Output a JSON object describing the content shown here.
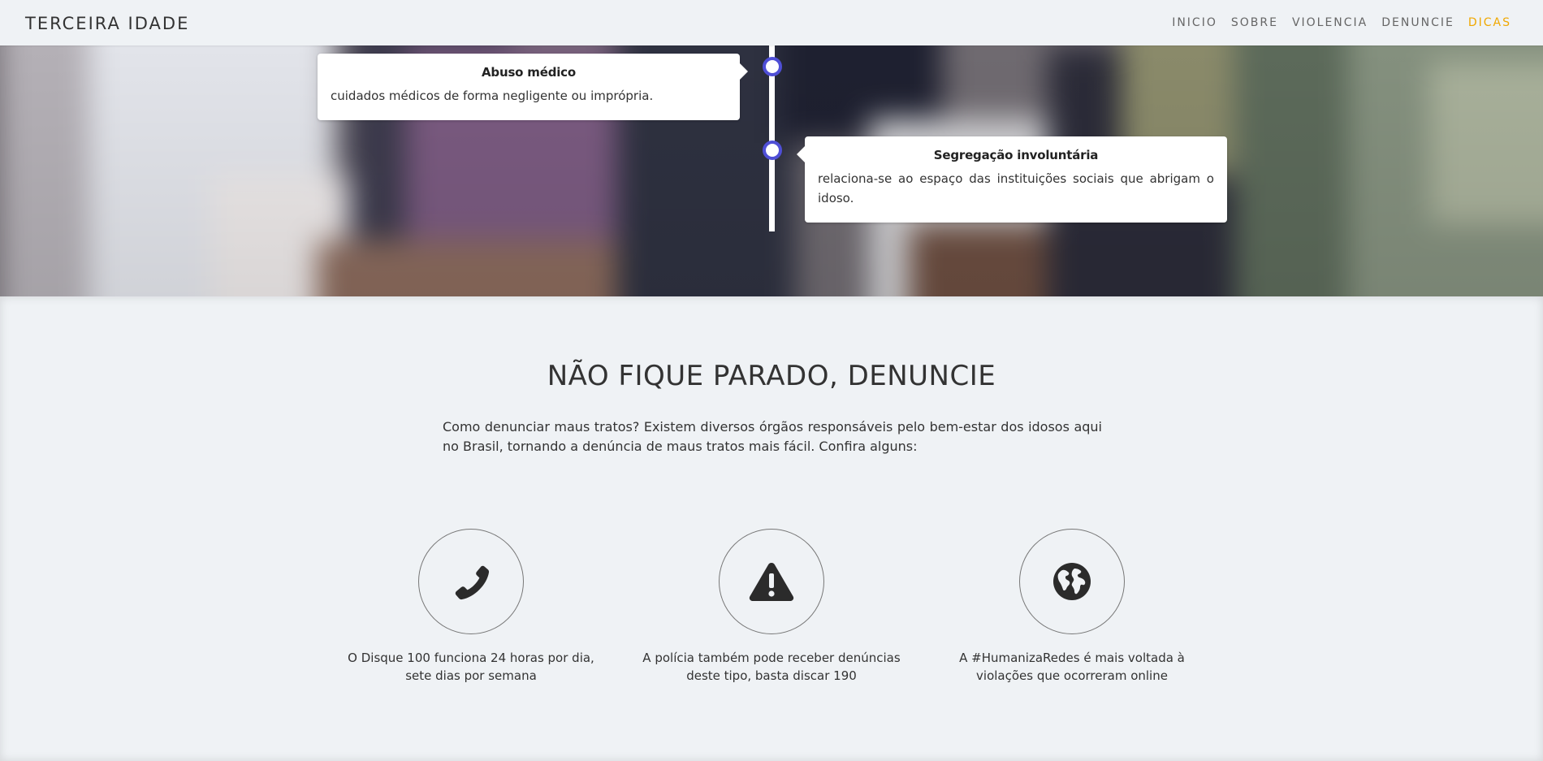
{
  "navbar": {
    "brand": "TERCEIRA IDADE",
    "links": [
      {
        "label": "INICIO"
      },
      {
        "label": "SOBRE"
      },
      {
        "label": "VIOLENCIA"
      },
      {
        "label": "DENUNCIE"
      },
      {
        "label": "DICAS"
      }
    ],
    "active_color": "#f0a800"
  },
  "timeline": {
    "accent_color": "#4f4fd6",
    "items": [
      {
        "title": "Abuso médico",
        "text": "cuidados médicos de forma negligente ou imprópria."
      },
      {
        "title": "Segregação involuntária",
        "text": "relaciona-se ao espaço das instituições sociais que abrigam o idoso."
      }
    ]
  },
  "denuncie": {
    "title": "NÃO FIQUE PARADO, DENUNCIE",
    "intro": "Como denunciar maus tratos?  Existem diversos órgãos responsáveis pelo bem-estar dos idosos aqui no Brasil, tornando a denúncia de maus tratos mais fácil. Confira alguns:",
    "features": [
      {
        "icon": "phone-icon",
        "text": "O Disque 100 funciona 24 horas por dia, sete dias por semana"
      },
      {
        "icon": "warning-icon",
        "text": "A polícia também pode receber denúncias deste tipo, basta discar 190"
      },
      {
        "icon": "globe-icon",
        "text": "A #HumanizaRedes é mais voltada à violações que ocorreram online"
      }
    ]
  }
}
